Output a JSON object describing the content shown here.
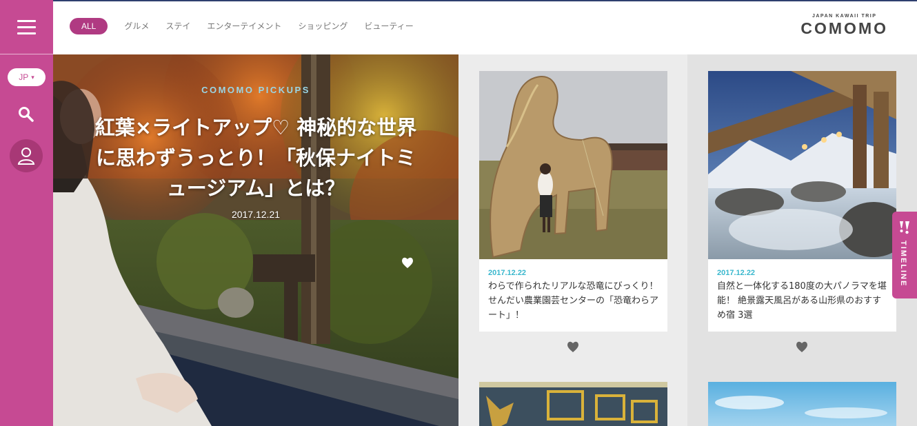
{
  "header": {
    "categories": [
      "ALL",
      "グルメ",
      "ステイ",
      "エンターテイメント",
      "ショッピング",
      "ビューティー"
    ],
    "logo_sub": "JAPAN KAWAII TRIP",
    "logo_main": "COMOMO"
  },
  "sidebar": {
    "language": "JP"
  },
  "hero": {
    "label": "COMOMO PICKUPS",
    "title": "紅葉×ライトアップ♡ 神秘的な世界に思わずうっとり！「秋保ナイトミュージアム」とは？",
    "date": "2017.12.21"
  },
  "cards": [
    {
      "date": "2017.12.22",
      "title": "わらで作られたリアルな恐竜にびっくり！ せんだい農業園芸センターの「恐竜わらアート」！"
    },
    {
      "date": "2017.12.22",
      "title": "自然と一体化する180度の大パノラマを堪能！ 絶景露天風呂がある山形県のおすすめ宿 3選"
    }
  ],
  "timeline": {
    "label": "TIMELINE"
  },
  "colors": {
    "brand": "#c64a93",
    "accent_date": "#39b7cd"
  },
  "icons": [
    "menu-icon",
    "chevron-down-icon",
    "search-icon",
    "user-icon",
    "heart-icon",
    "timeline-icon"
  ]
}
